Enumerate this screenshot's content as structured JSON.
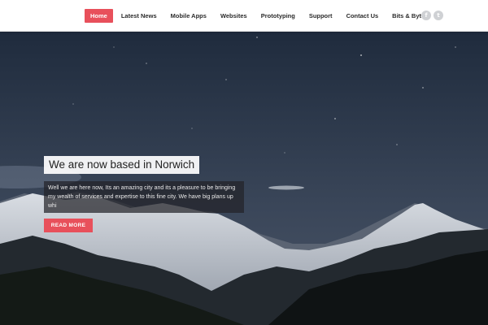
{
  "nav": {
    "items": [
      {
        "label": "Home",
        "active": true
      },
      {
        "label": "Latest News",
        "active": false
      },
      {
        "label": "Mobile Apps",
        "active": false
      },
      {
        "label": "Websites",
        "active": false
      },
      {
        "label": "Prototyping",
        "active": false
      },
      {
        "label": "Support",
        "active": false
      },
      {
        "label": "Contact Us",
        "active": false
      },
      {
        "label": "Bits & Bytes",
        "active": false
      }
    ]
  },
  "social": {
    "facebook": {
      "glyph": "f",
      "icon": "facebook-icon"
    },
    "twitter": {
      "glyph": "t",
      "icon": "twitter-icon"
    }
  },
  "hero": {
    "title": "We are now based in Norwich",
    "description": "Well we are here now, Its an amazing city and its a pleasure to be bringing my wealth of services and expertise to this fine city. We have big plans up whi",
    "button_label": "READ MORE"
  },
  "colors": {
    "accent": "#e8505b",
    "header_bg": "#ffffff",
    "sky_top": "#243246",
    "sky_bottom": "#47546a"
  }
}
